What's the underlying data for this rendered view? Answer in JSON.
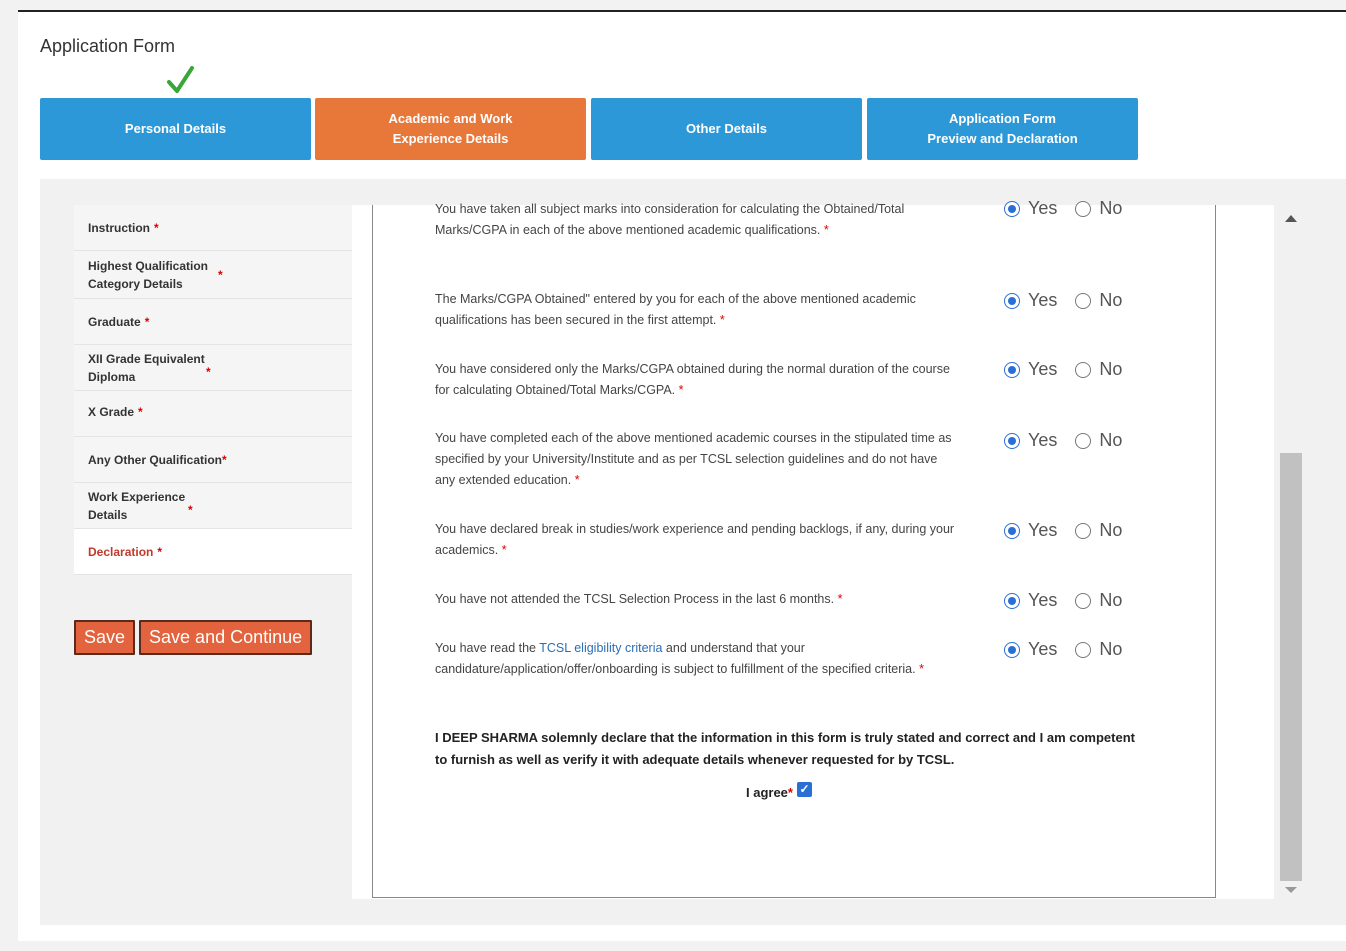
{
  "page_title": "Application Form",
  "tabs": [
    {
      "label": "Personal Details",
      "active": false,
      "completed": true
    },
    {
      "label": "Academic and Work Experience Details",
      "active": true
    },
    {
      "label": "Other Details",
      "active": false
    },
    {
      "label": "Application Form Preview and Declaration",
      "active": false
    }
  ],
  "sidebar": {
    "items": [
      {
        "label": "Instruction",
        "star": "*"
      },
      {
        "label": "Highest Qualification Category Details",
        "star": "*"
      },
      {
        "label": "Graduate",
        "star": "*"
      },
      {
        "label": "XII Grade Equivalent Diploma",
        "star": "*"
      },
      {
        "label": "X Grade",
        "star": "*"
      },
      {
        "label": "Any Other Qualification",
        "star": "*"
      },
      {
        "label": "Work Experience Details",
        "star": "*"
      },
      {
        "label": "Declaration",
        "star": "*",
        "active": true
      }
    ]
  },
  "buttons": {
    "save": "Save",
    "save_continue": "Save and Continue"
  },
  "questions": [
    {
      "text": "You have taken all subject marks into consideration for calculating the Obtained/Total Marks/CGPA in each of the above mentioned academic qualifications.",
      "req": "*",
      "answer": "Yes"
    },
    {
      "text": "The Marks/CGPA Obtained\" entered by you for each of the above mentioned academic qualifications has been secured in the first attempt.",
      "req": "*",
      "answer": "Yes"
    },
    {
      "text": "You have considered only the Marks/CGPA obtained during the normal duration of the course for calculating Obtained/Total Marks/CGPA.",
      "req": "*",
      "answer": "Yes"
    },
    {
      "text": "You have completed each of the above mentioned academic courses in the stipulated time as specified by your University/Institute and as per TCSL selection guidelines and do not have any extended education.",
      "req": "*",
      "answer": "Yes"
    },
    {
      "text": "You have declared break in studies/work experience and pending backlogs, if any, during your academics.",
      "req": "*",
      "answer": "Yes"
    },
    {
      "text": "You have not attended the TCSL Selection Process in the last 6 months.",
      "req": "*",
      "answer": "Yes"
    },
    {
      "text_before": "You have read the ",
      "link": "TCSL eligibility criteria",
      "text_after": " and understand that your candidature/application/offer/onboarding is subject to fulfillment of the specified criteria.",
      "req": "*",
      "answer": "Yes"
    }
  ],
  "options": {
    "yes": "Yes",
    "no": "No"
  },
  "declaration": "I DEEP SHARMA solemnly declare that the information in this form is truly stated and correct and I am competent to furnish as well as verify it with adequate details whenever requested for by TCSL.",
  "agree": {
    "label": "I agree",
    "req": "*",
    "checked": true
  },
  "colors": {
    "tab_blue": "#2d98d8",
    "tab_active": "#e8773a",
    "button": "#e2633d",
    "check_green": "#3aa63a",
    "radio_blue": "#2a6fd6"
  }
}
